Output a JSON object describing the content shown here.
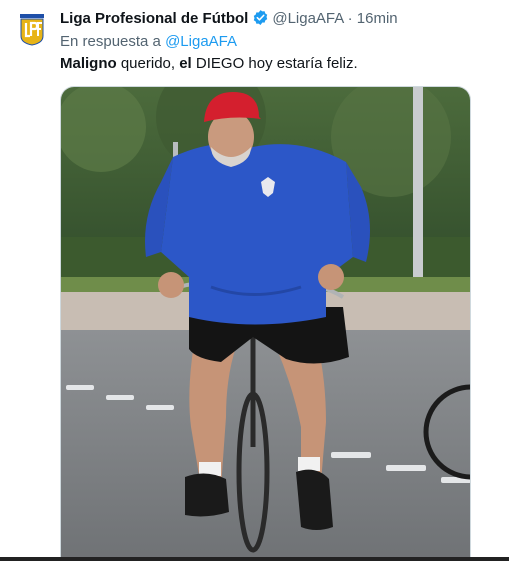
{
  "tweet": {
    "author_name": "Liga Profesional de Fútbol",
    "handle": "@LigaAFA",
    "separator": "·",
    "time": "16min",
    "reply_prefix": "En respuesta a",
    "reply_to": "@LigaAFA",
    "text_bold_1": "Maligno",
    "text_plain_1": " querido, ",
    "text_bold_2": "el",
    "text_plain_2": " DIEGO hoy estaría feliz."
  },
  "avatar_logo_text": "LPF",
  "colors": {
    "link": "#1d9bf0",
    "muted": "#536471",
    "verified": "#1d9bf0",
    "logo_gold": "#e7b417",
    "logo_blue": "#1e4fa8",
    "jacket_blue": "#2c57c8",
    "cap_red": "#d41f2e"
  },
  "media": {
    "icon": "photo"
  }
}
